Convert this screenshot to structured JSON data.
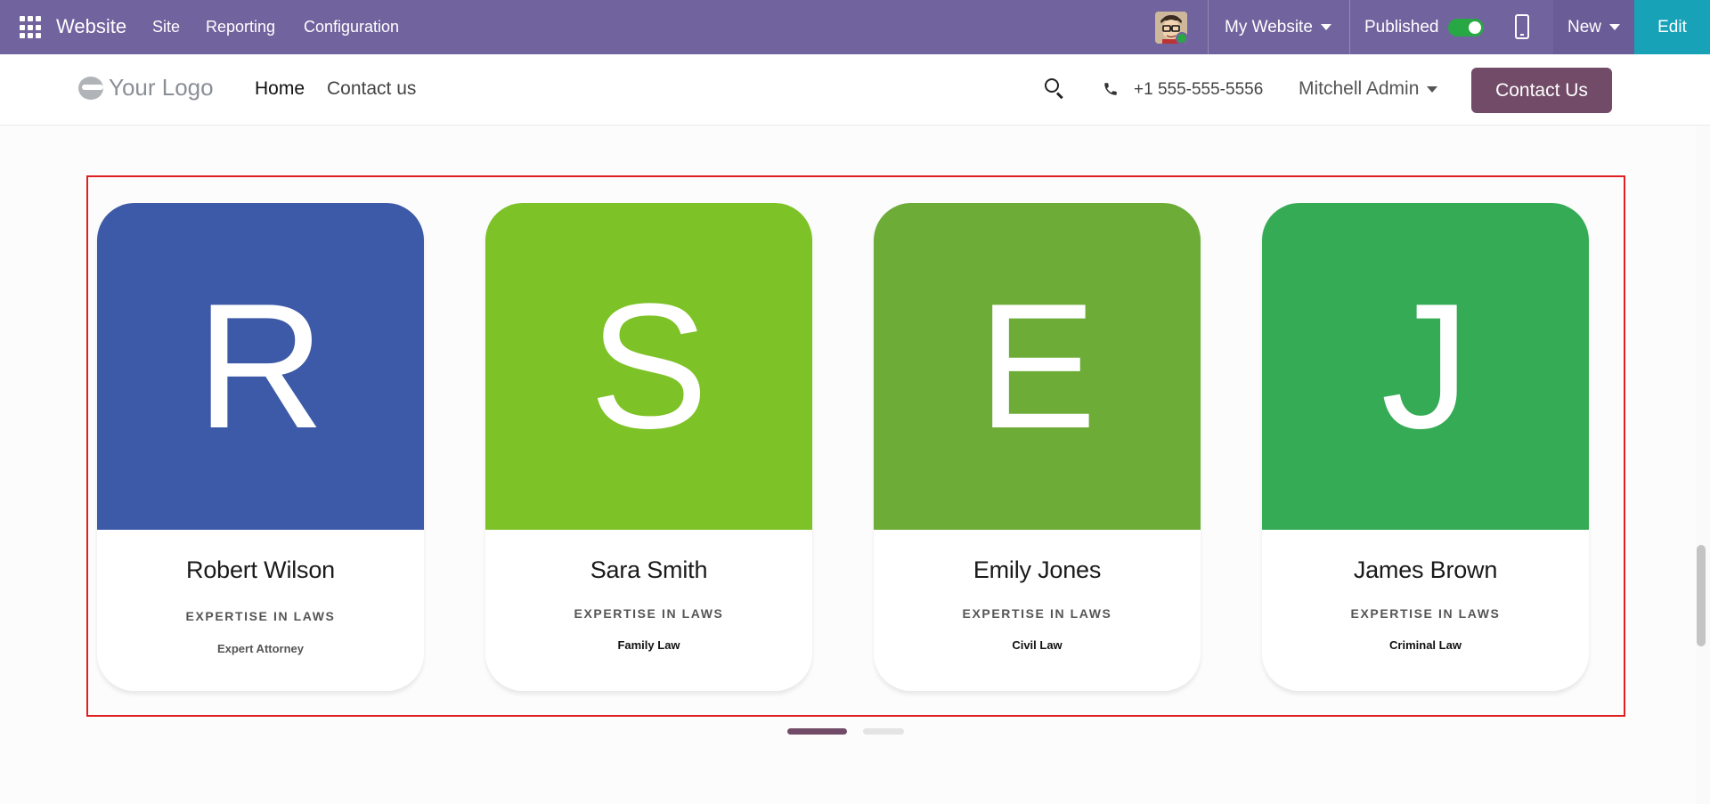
{
  "admin_bar": {
    "brand": "Website",
    "menus": [
      "Site",
      "Reporting",
      "Configuration"
    ],
    "website_switch": "My Website",
    "published_label": "Published",
    "published": true,
    "new_label": "New",
    "edit_label": "Edit"
  },
  "site_header": {
    "logo_text": "Your Logo",
    "nav": [
      "Home",
      "Contact us"
    ],
    "phone": "+1 555-555-5556",
    "user": "Mitchell Admin",
    "cta": "Contact Us"
  },
  "team": [
    {
      "initial": "R",
      "name": "Robert Wilson",
      "role": "EXPERTISE IN LAWS",
      "specialty": "Expert Attorney",
      "color": "#3d5aa8"
    },
    {
      "initial": "S",
      "name": "Sara Smith",
      "role": "EXPERTISE IN LAWS",
      "specialty": "Family Law",
      "color": "#7dc226"
    },
    {
      "initial": "E",
      "name": "Emily Jones",
      "role": "EXPERTISE IN LAWS",
      "specialty": "Civil Law",
      "color": "#6eac38"
    },
    {
      "initial": "J",
      "name": "James Brown",
      "role": "EXPERTISE IN LAWS",
      "specialty": "Criminal Law",
      "color": "#35ab55"
    }
  ],
  "carousel": {
    "pages": 2,
    "active_page": 1
  },
  "colors": {
    "admin_bar": "#71639e",
    "edit": "#17a2b8",
    "primary": "#714b67",
    "highlight": "#e02020"
  }
}
